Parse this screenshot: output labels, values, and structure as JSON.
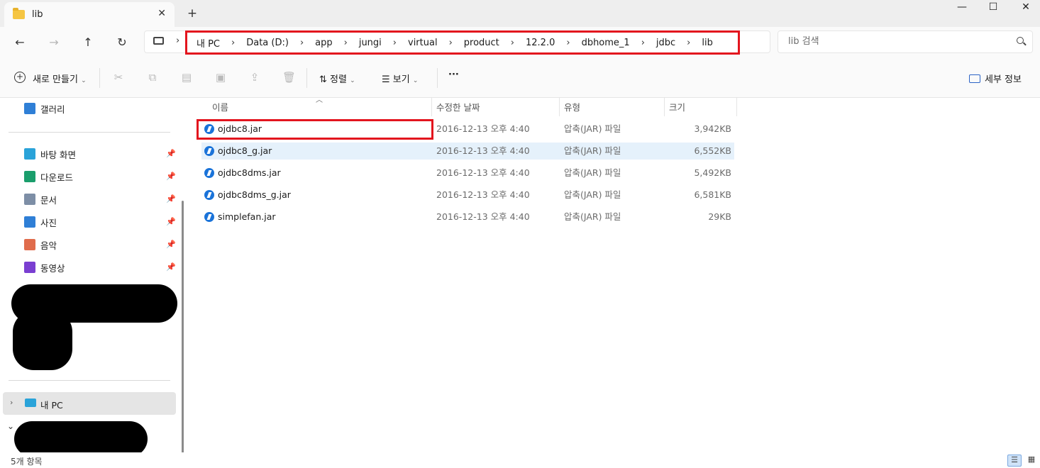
{
  "window": {
    "tab_title": "lib",
    "minimize_glyph": "—",
    "maximize_glyph": "☐",
    "close_glyph": "✕",
    "new_tab_glyph": "+"
  },
  "nav": {
    "back_glyph": "←",
    "forward_glyph": "→",
    "up_glyph": "↑",
    "refresh_glyph": "↻",
    "breadcrumbs": [
      "내 PC",
      "Data (D:)",
      "app",
      "jungi",
      "virtual",
      "product",
      "12.2.0",
      "dbhome_1",
      "jdbc",
      "lib"
    ],
    "crumb_sep": "›",
    "search_placeholder": "lib 검색"
  },
  "toolbar": {
    "new_label": "새로 만들기",
    "sort_label": "정렬",
    "view_label": "보기",
    "more_label": "···",
    "details_label": "세부 정보"
  },
  "sidebar": {
    "gallery": "갤러리",
    "quick": [
      {
        "label": "바탕 화면",
        "icon": "desktop-icon",
        "color": "#2aa3d9"
      },
      {
        "label": "다운로드",
        "icon": "download-icon",
        "color": "#1a9e6c"
      },
      {
        "label": "문서",
        "icon": "document-icon",
        "color": "#7d8ea6"
      },
      {
        "label": "사진",
        "icon": "pictures-icon",
        "color": "#2f7fd6"
      },
      {
        "label": "음악",
        "icon": "music-icon",
        "color": "#e06c4c"
      },
      {
        "label": "동영상",
        "icon": "video-icon",
        "color": "#7a3fd1"
      }
    ],
    "this_pc": "내 PC"
  },
  "columns": {
    "name": "이름",
    "date": "수정한 날짜",
    "type": "유형",
    "size": "크기"
  },
  "files": [
    {
      "name": "ojdbc8.jar",
      "date": "2016-12-13 오후 4:40",
      "type": "압축(JAR) 파일",
      "size": "3,942KB"
    },
    {
      "name": "ojdbc8_g.jar",
      "date": "2016-12-13 오후 4:40",
      "type": "압축(JAR) 파일",
      "size": "6,552KB"
    },
    {
      "name": "ojdbc8dms.jar",
      "date": "2016-12-13 오후 4:40",
      "type": "압축(JAR) 파일",
      "size": "5,492KB"
    },
    {
      "name": "ojdbc8dms_g.jar",
      "date": "2016-12-13 오후 4:40",
      "type": "압축(JAR) 파일",
      "size": "6,581KB"
    },
    {
      "name": "simplefan.jar",
      "date": "2016-12-13 오후 4:40",
      "type": "압축(JAR) 파일",
      "size": "29KB"
    }
  ],
  "status": {
    "count": "5개 항목"
  }
}
